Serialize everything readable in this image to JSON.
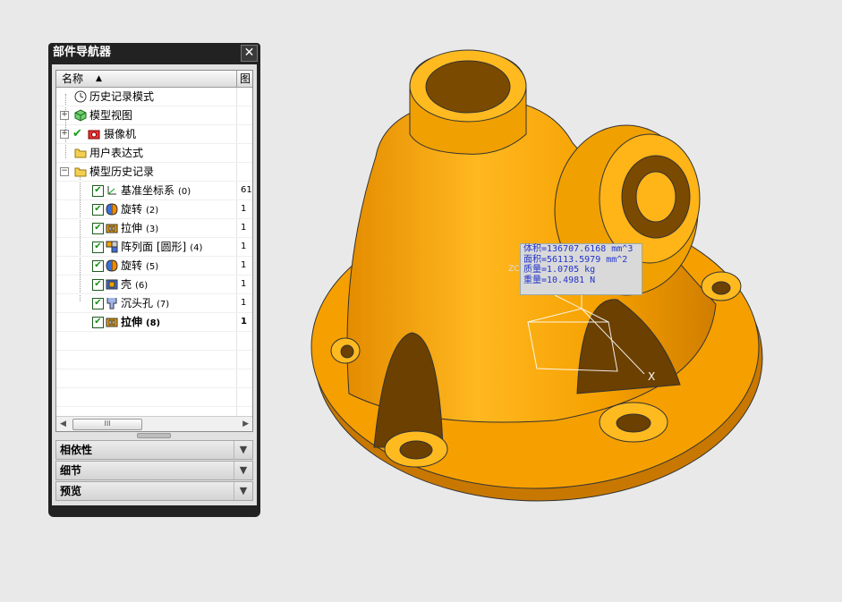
{
  "navigator": {
    "title": "部件导航器",
    "close_label": "✕",
    "columns": {
      "name": "名称",
      "sort_icon": "▲",
      "col2": "图"
    },
    "nodes": [
      {
        "label": "历史记录模式",
        "icon": "clock-icon",
        "value": ""
      },
      {
        "label": "模型视图",
        "icon": "model-view-icon",
        "value": "",
        "expander": "+"
      },
      {
        "label": "摄像机",
        "icon": "camera-icon",
        "value": "",
        "expander": "+"
      },
      {
        "label": "用户表达式",
        "icon": "folder-icon",
        "value": ""
      },
      {
        "label": "模型历史记录",
        "icon": "folder-icon",
        "value": "",
        "expander": "−"
      },
      {
        "label": "基准坐标系",
        "num": "(0)",
        "icon": "datum-csys-icon",
        "value": "61",
        "checked": true
      },
      {
        "label": "旋转",
        "num": "(2)",
        "icon": "revolve-icon",
        "value": "1",
        "checked": true
      },
      {
        "label": "拉伸",
        "num": "(3)",
        "icon": "extrude-icon",
        "value": "1",
        "checked": true
      },
      {
        "label": "阵列面 [圆形]",
        "num": "(4)",
        "icon": "pattern-face-icon",
        "value": "1",
        "checked": true
      },
      {
        "label": "旋转",
        "num": "(5)",
        "icon": "revolve-icon",
        "value": "1",
        "checked": true
      },
      {
        "label": "壳",
        "num": "(6)",
        "icon": "shell-icon",
        "value": "1",
        "checked": true
      },
      {
        "label": "沉头孔",
        "num": "(7)",
        "icon": "counterbore-hole-icon",
        "value": "1",
        "checked": true
      },
      {
        "label": "拉伸",
        "num": "(8)",
        "icon": "extrude-icon",
        "value": "1",
        "checked": true,
        "bold": true
      }
    ],
    "scroll_thumb": "III",
    "sections": [
      {
        "label": "相依性",
        "icon": "chevron-down-icon"
      },
      {
        "label": "细节",
        "icon": "chevron-down-icon"
      },
      {
        "label": "预览",
        "icon": "chevron-down-icon"
      }
    ]
  },
  "measure_info": {
    "lines": [
      "体积=136707.6168 mm^3",
      "面积=56113.5979 mm^2",
      "质量=1.0705 kg",
      "重量=10.4981 N"
    ]
  },
  "viewport": {
    "axis_x_label": "X",
    "axis_z_label": "ZC",
    "model_color": "#f5a000",
    "model_shade": "#d98500",
    "model_light": "#ffbe2a"
  }
}
